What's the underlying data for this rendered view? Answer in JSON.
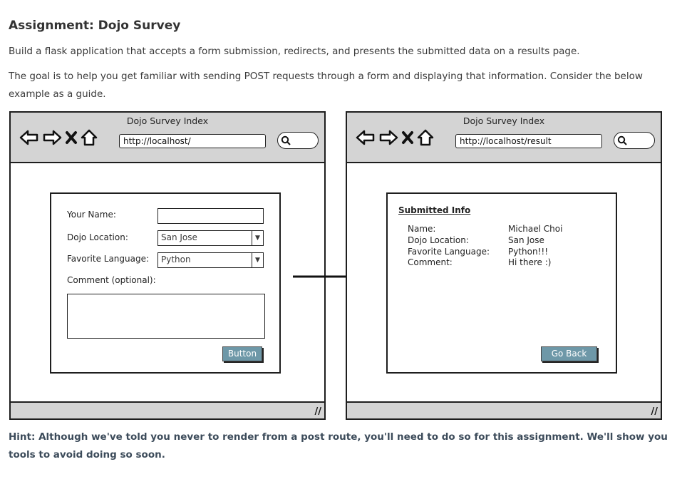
{
  "title": "Assignment: Dojo Survey",
  "intro": "Build a flask application that accepts a form submission, redirects, and presents the submitted data on a results page.",
  "goal": "The goal is to help you get familiar with sending POST requests through a form and displaying that information. Consider the below example as a guide.",
  "left_window": {
    "title": "Dojo Survey Index",
    "url": "http://localhost/",
    "form": {
      "name_label": "Your Name:",
      "name_value": "",
      "location_label": "Dojo Location:",
      "location_value": "San Jose",
      "language_label": "Favorite Language:",
      "language_value": "Python",
      "comment_label": "Comment (optional):",
      "button_label": "Button"
    }
  },
  "right_window": {
    "title": "Dojo Survey Index",
    "url": "http://localhost/result",
    "heading": "Submitted Info",
    "rows": [
      {
        "key": "Name:",
        "value": "Michael Choi"
      },
      {
        "key": "Dojo Location:",
        "value": "San Jose"
      },
      {
        "key": "Favorite Language:",
        "value": "Python!!!"
      },
      {
        "key": "Comment:",
        "value": "Hi there :)"
      }
    ],
    "button_label": "Go Back"
  },
  "hint": "Hint: Although we've told you never to render from a post route, you'll need to do so for this assignment. We'll show you tools to avoid doing so soon.",
  "icons": {
    "back": "back-arrow-icon",
    "forward": "forward-arrow-icon",
    "stop": "stop-x-icon",
    "home": "home-icon",
    "search": "search-icon",
    "grip": "resize-grip-icon"
  },
  "colors": {
    "button": "#6e98a8",
    "chrome": "#d4d4d4",
    "hint_text": "#3c4b5a"
  }
}
